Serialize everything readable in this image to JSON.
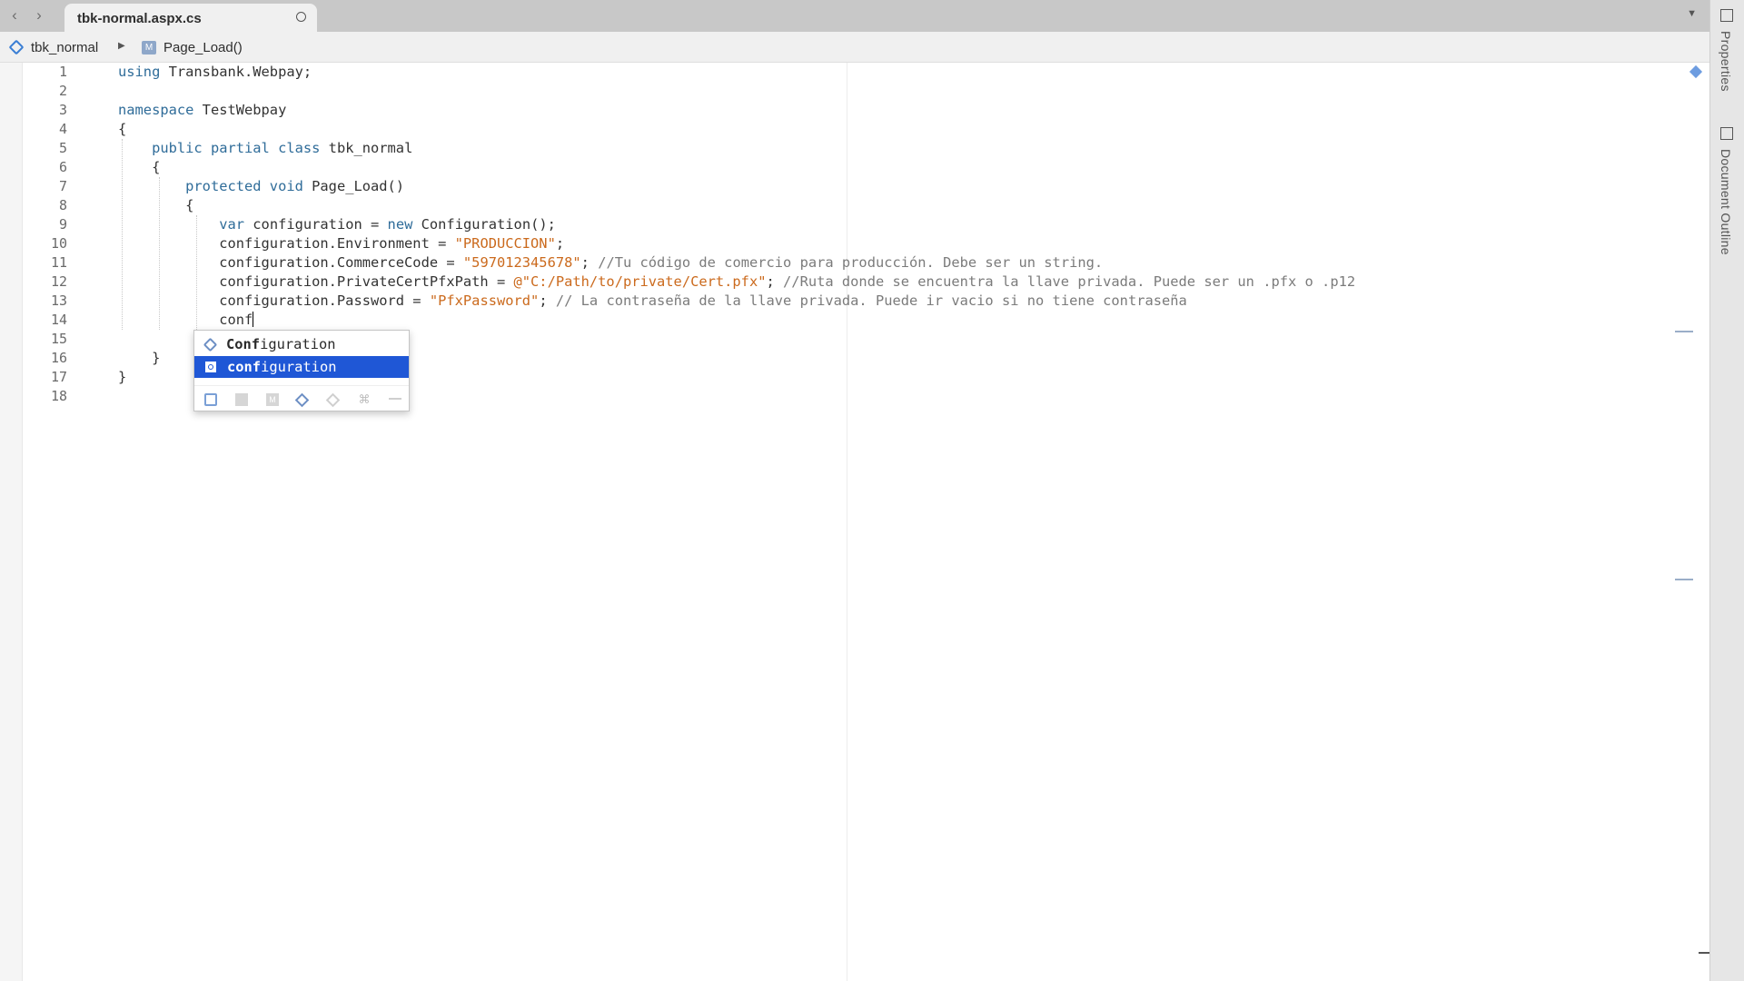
{
  "tab": {
    "title": "tbk-normal.aspx.cs",
    "back_icon": "‹",
    "forward_icon": "›",
    "dropdown_icon": "▼"
  },
  "breadcrumb": {
    "class_name": "tbk_normal",
    "separator": "▶",
    "method_name": "Page_Load()",
    "method_icon_letter": "M"
  },
  "editor": {
    "line_numbers": [
      "1",
      "2",
      "3",
      "4",
      "5",
      "6",
      "7",
      "8",
      "9",
      "10",
      "11",
      "12",
      "13",
      "14",
      "15",
      "16",
      "17",
      "18"
    ],
    "lines": [
      [
        {
          "t": "using",
          "c": "kw"
        },
        {
          "t": " Transbank.Webpay;"
        }
      ],
      [],
      [
        {
          "t": "namespace",
          "c": "kw"
        },
        {
          "t": " TestWebpay"
        }
      ],
      [
        {
          "t": "{"
        }
      ],
      [
        {
          "t": "    "
        },
        {
          "t": "public partial class",
          "c": "kw"
        },
        {
          "t": " tbk_normal"
        }
      ],
      [
        {
          "t": "    {"
        }
      ],
      [
        {
          "t": "        "
        },
        {
          "t": "protected void",
          "c": "kw"
        },
        {
          "t": " Page_Load()"
        }
      ],
      [
        {
          "t": "        {"
        }
      ],
      [
        {
          "t": "            "
        },
        {
          "t": "var",
          "c": "kw"
        },
        {
          "t": " configuration = "
        },
        {
          "t": "new",
          "c": "kw"
        },
        {
          "t": " Configuration();"
        }
      ],
      [
        {
          "t": "            configuration.Environment = "
        },
        {
          "t": "\"PRODUCCION\"",
          "c": "str"
        },
        {
          "t": ";"
        }
      ],
      [
        {
          "t": "            configuration.CommerceCode = "
        },
        {
          "t": "\"597012345678\"",
          "c": "str"
        },
        {
          "t": "; "
        },
        {
          "t": "//Tu código de comercio para producción. Debe ser un string.",
          "c": "cmt"
        }
      ],
      [
        {
          "t": "            configuration.PrivateCertPfxPath = "
        },
        {
          "t": "@\"C:/Path/to/private/Cert.pfx\"",
          "c": "str"
        },
        {
          "t": "; "
        },
        {
          "t": "//Ruta donde se encuentra la llave privada. Puede ser un .pfx o .p12",
          "c": "cmt"
        }
      ],
      [
        {
          "t": "            configuration.Password = "
        },
        {
          "t": "\"PfxPassword\"",
          "c": "str"
        },
        {
          "t": "; "
        },
        {
          "t": "// La contraseña de la llave privada. Puede ir vacio si no tiene contraseña",
          "c": "cmt"
        }
      ],
      [
        {
          "t": "            conf"
        },
        {
          "caret": true
        }
      ],
      [],
      [
        {
          "t": "    }"
        }
      ],
      [
        {
          "t": "}"
        }
      ],
      []
    ]
  },
  "completion": {
    "items": [
      {
        "match": "Conf",
        "rest": "iguration",
        "icon": "class-icon"
      },
      {
        "match": "conf",
        "rest": "iguration",
        "icon": "variable-icon",
        "selected": true
      }
    ],
    "filter_icons": [
      "local-filter-icon",
      "field-filter-icon",
      "method-filter-icon",
      "class-filter-icon",
      "interface-filter-icon",
      "keyword-filter-icon",
      "other-filter-icon"
    ],
    "keyword_filter_glyph": "⌘",
    "method_filter_letter": "M"
  },
  "side_panel": {
    "properties_label": "Properties",
    "outline_label": "Document Outline"
  },
  "colors": {
    "keyword": "#2f6c99",
    "string": "#cb6a1d",
    "comment": "#7b7b7b",
    "selection": "#1f57d6"
  }
}
